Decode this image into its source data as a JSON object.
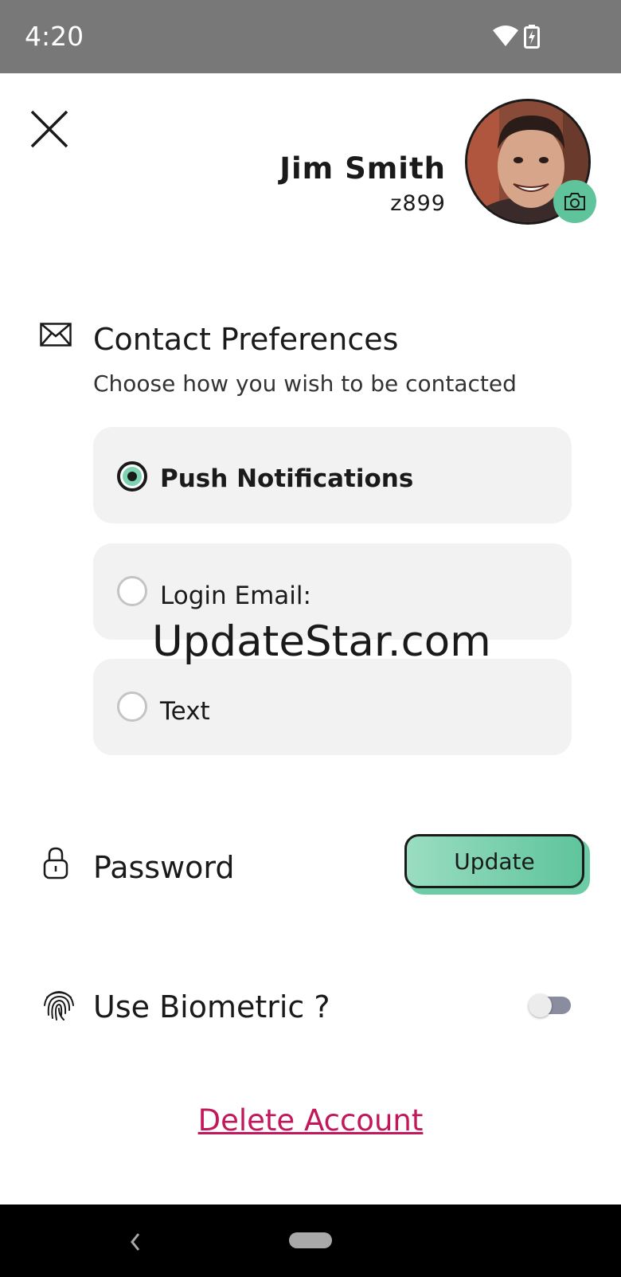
{
  "status_bar": {
    "time": "4:20",
    "icons": [
      "wifi-icon",
      "battery-charging-icon"
    ]
  },
  "header": {
    "close_icon": "close-icon",
    "user_name": "Jim Smith",
    "user_id": "z899",
    "avatar_icon": "avatar",
    "camera_icon": "camera-icon"
  },
  "contact": {
    "icon": "mail-icon",
    "title": "Contact Preferences",
    "subtitle": "Choose how you wish to be contacted",
    "options": [
      {
        "label": "Push Notifications",
        "selected": true
      },
      {
        "label": "Login Email:",
        "selected": false
      },
      {
        "label": "Text",
        "selected": false
      }
    ]
  },
  "watermark": "UpdateStar.com",
  "password": {
    "icon": "lock-icon",
    "label": "Password",
    "button_label": "Update"
  },
  "biometric": {
    "icon": "fingerprint-icon",
    "label": "Use Biometric ?",
    "enabled": false
  },
  "delete_label": "Delete Account",
  "colors": {
    "accent": "#5fc49c",
    "danger": "#c2185b",
    "card_bg": "#f2f2f2",
    "status_bar": "#787878"
  }
}
